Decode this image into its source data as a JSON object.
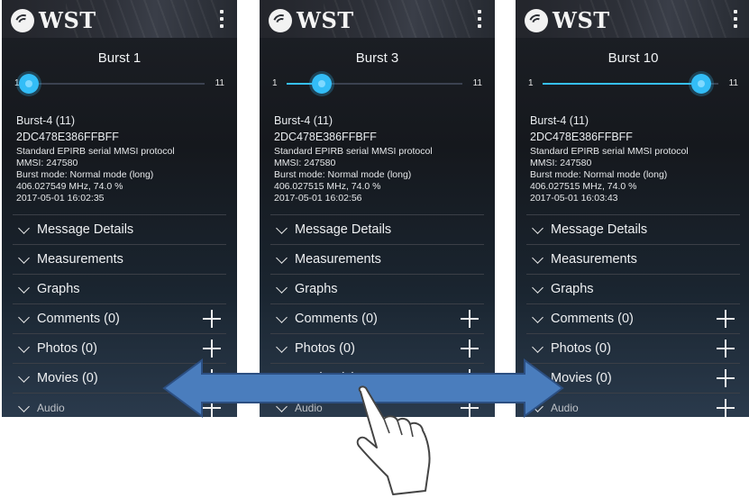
{
  "app": {
    "logo_text": "WST"
  },
  "screens": [
    {
      "title": "Burst 1",
      "slider": {
        "min": "1",
        "max": "11",
        "value": 1
      },
      "info": {
        "name": "Burst-4 (11)",
        "hex": "2DC478E386FFBFF",
        "protocol": "Standard EPIRB serial MMSI protocol",
        "mmsi": "MMSI: 247580",
        "mode": "Burst mode: Normal mode (long)",
        "freq": "406.027549 MHz, 74.0 %",
        "timestamp": "2017-05-01 16:02:35"
      }
    },
    {
      "title": "Burst 3",
      "slider": {
        "min": "1",
        "max": "11",
        "value": 3
      },
      "info": {
        "name": "Burst-4 (11)",
        "hex": "2DC478E386FFBFF",
        "protocol": "Standard EPIRB serial MMSI protocol",
        "mmsi": "MMSI: 247580",
        "mode": "Burst mode: Normal mode (long)",
        "freq": "406.027515 MHz, 74.0 %",
        "timestamp": "2017-05-01 16:02:56"
      }
    },
    {
      "title": "Burst 10",
      "slider": {
        "min": "1",
        "max": "11",
        "value": 10
      },
      "info": {
        "name": "Burst-4 (11)",
        "hex": "2DC478E386FFBFF",
        "protocol": "Standard EPIRB serial MMSI protocol",
        "mmsi": "MMSI: 247580",
        "mode": "Burst mode: Normal mode (long)",
        "freq": "406.027515 MHz, 74.0 %",
        "timestamp": "2017-05-01 16:03:43"
      }
    }
  ],
  "sections": {
    "message_details": "Message Details",
    "measurements": "Measurements",
    "graphs": "Graphs",
    "comments": "Comments (0)",
    "photos": "Photos (0)",
    "movies": "Movies (0)",
    "audio": "Audio"
  },
  "colors": {
    "accent": "#33bdf7",
    "arrow": "#4a7dbd",
    "background": "#15181d"
  },
  "overlay": {
    "arrow_icon": "double-headed-arrow-icon",
    "hand_icon": "pointing-hand-icon"
  }
}
